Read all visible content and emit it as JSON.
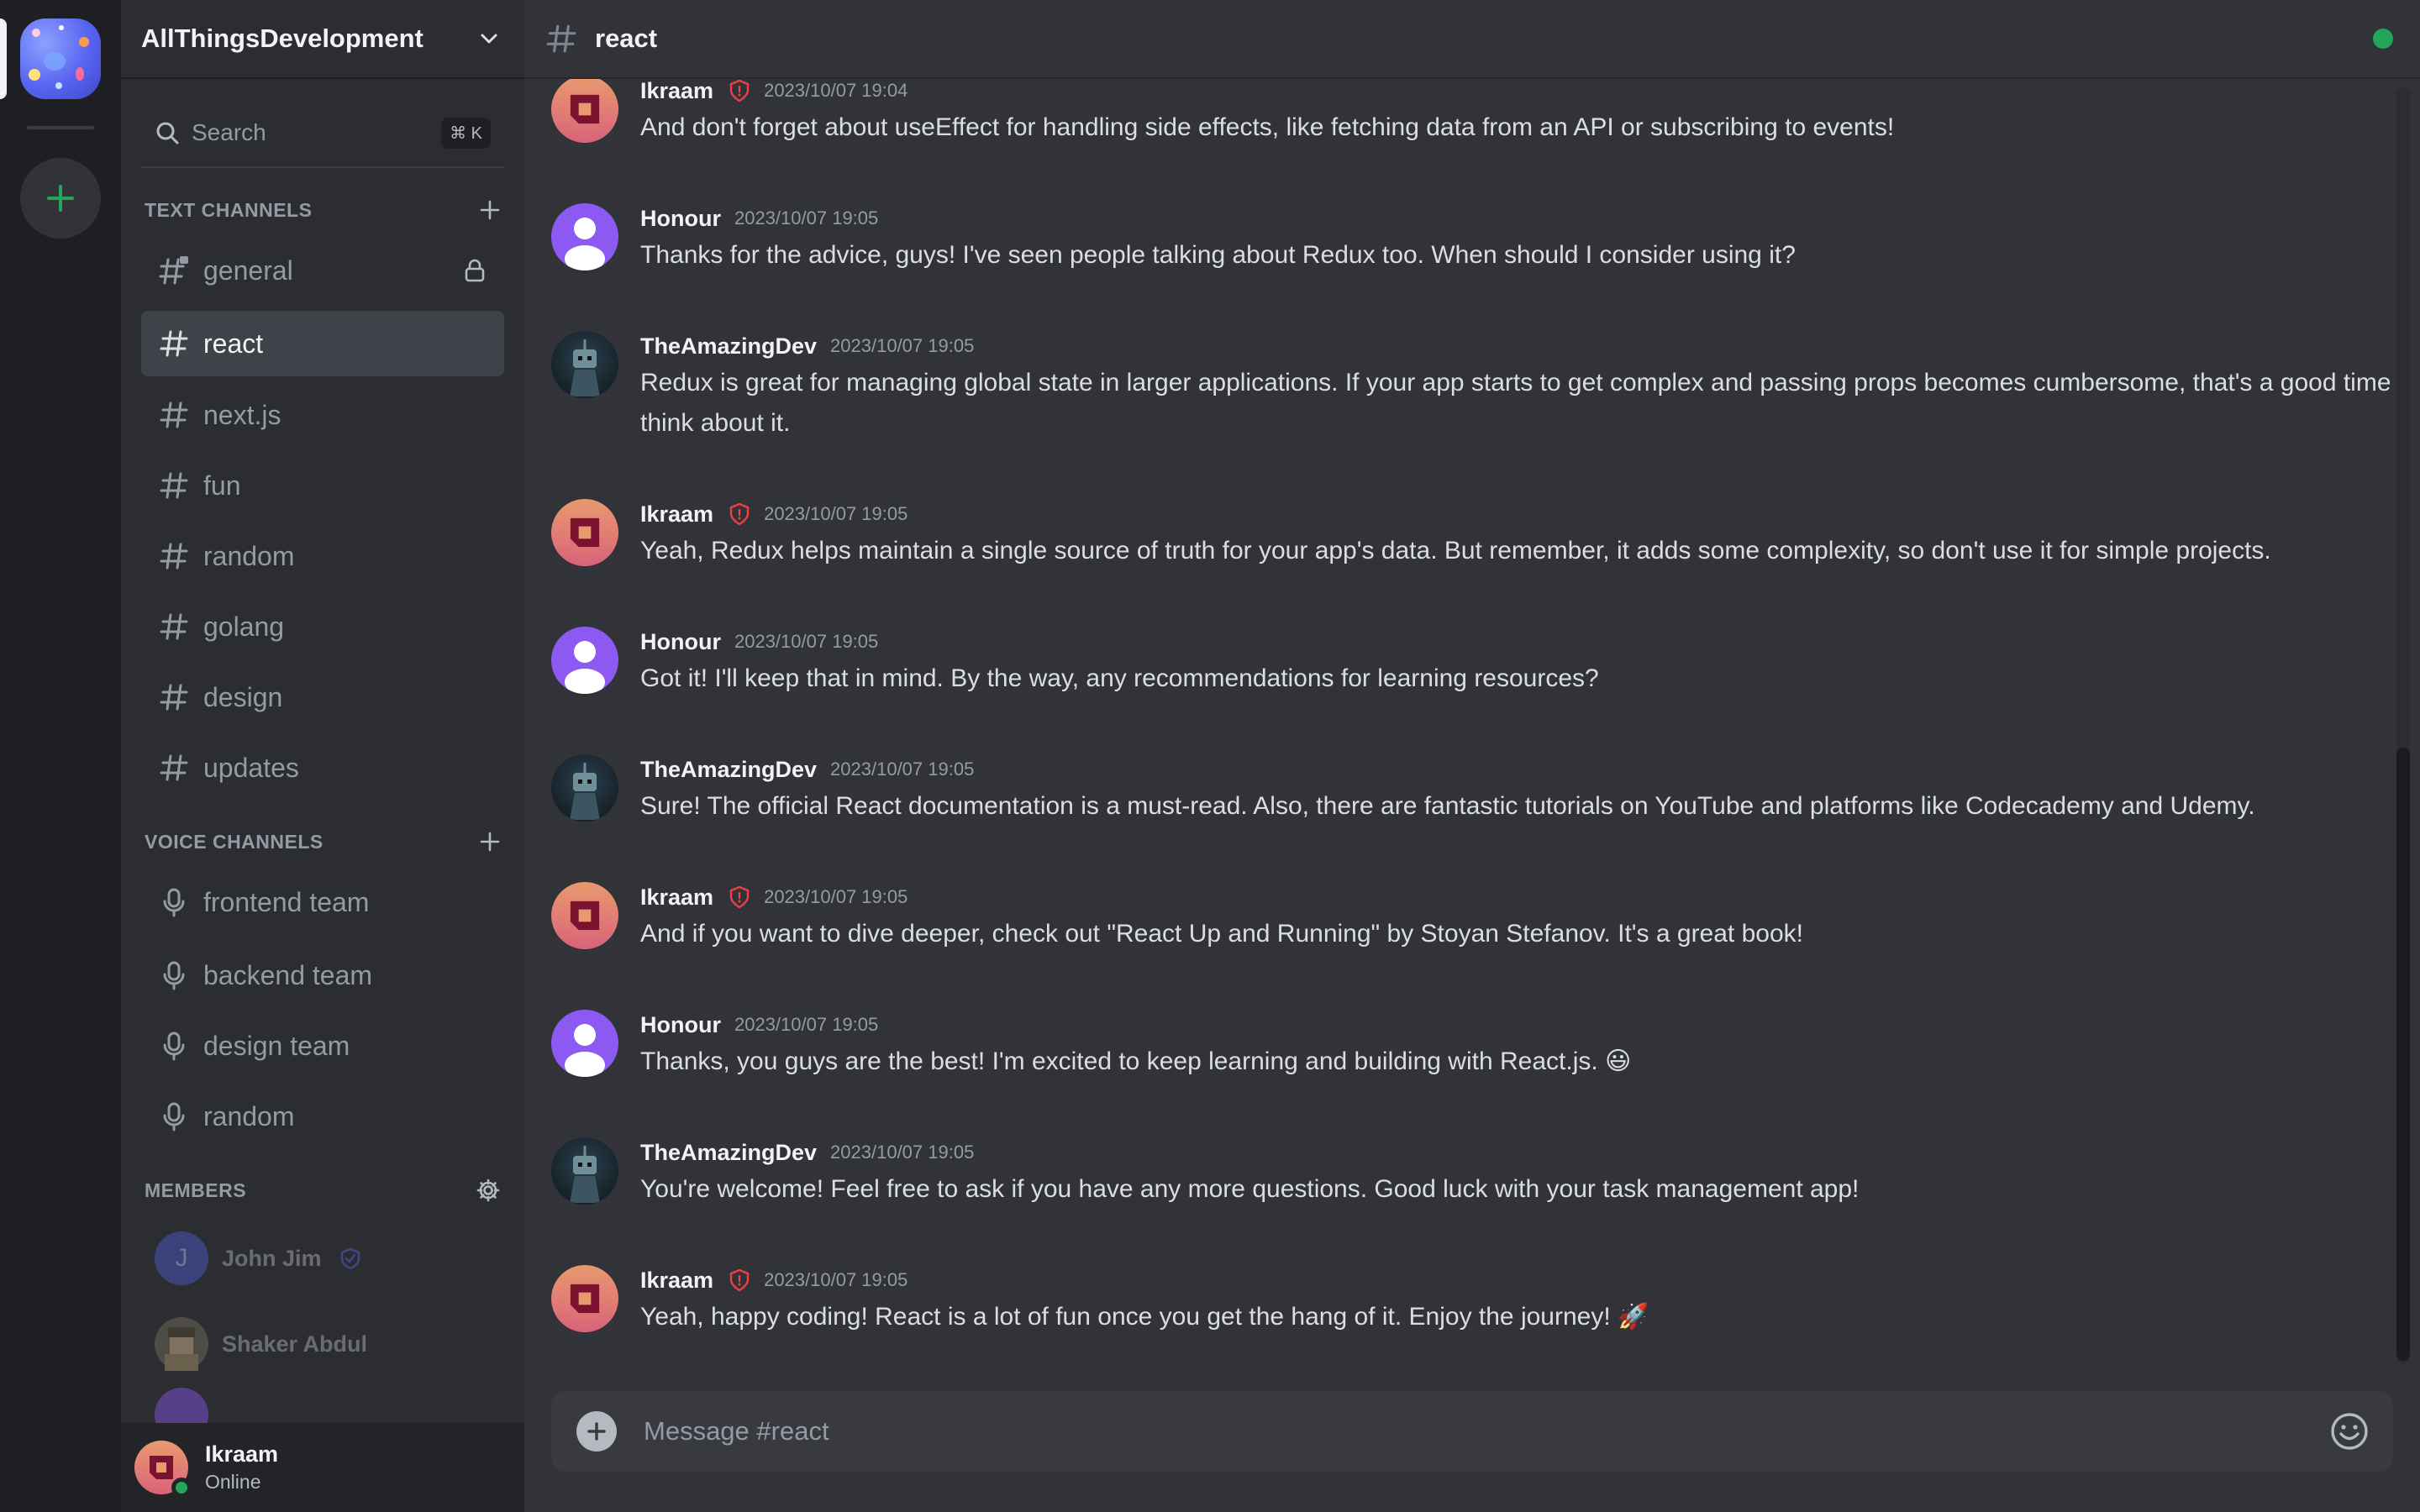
{
  "server": {
    "name": "AllThingsDevelopment"
  },
  "search": {
    "placeholder": "Search",
    "shortcut": "⌘ K"
  },
  "sections": {
    "text": "TEXT CHANNELS",
    "voice": "VOICE CHANNELS",
    "members": "MEMBERS"
  },
  "text_channels": [
    {
      "name": "general"
    },
    {
      "name": "react"
    },
    {
      "name": "next.js"
    },
    {
      "name": "fun"
    },
    {
      "name": "random"
    },
    {
      "name": "golang"
    },
    {
      "name": "design"
    },
    {
      "name": "updates"
    }
  ],
  "voice_channels": [
    {
      "name": "frontend team"
    },
    {
      "name": "backend team"
    },
    {
      "name": "design team"
    },
    {
      "name": "random"
    }
  ],
  "members": [
    {
      "name": "John Jim",
      "initial": "J"
    },
    {
      "name": "Shaker Abdul"
    }
  ],
  "current_user": {
    "name": "Ikraam",
    "status": "Online"
  },
  "chat": {
    "channel": "react",
    "placeholder": "Message #react"
  },
  "messages": [
    {
      "author": "Ikraam",
      "time": "2023/10/07 19:04",
      "text": "And don't forget about useEffect for handling side effects, like fetching data from an API or subscribing to events!"
    },
    {
      "author": "Honour",
      "time": "2023/10/07 19:05",
      "text": "Thanks for the advice, guys! I've seen people talking about Redux too. When should I consider using it?"
    },
    {
      "author": "TheAmazingDev",
      "time": "2023/10/07 19:05",
      "text": "Redux is great for managing global state in larger applications. If your app starts to get complex and passing props becomes cumbersome, that's a good time to think about it."
    },
    {
      "author": "Ikraam",
      "time": "2023/10/07 19:05",
      "text": "Yeah, Redux helps maintain a single source of truth for your app's data. But remember, it adds some complexity, so don't use it for simple projects."
    },
    {
      "author": "Honour",
      "time": "2023/10/07 19:05",
      "text": "Got it! I'll keep that in mind. By the way, any recommendations for learning resources?"
    },
    {
      "author": "TheAmazingDev",
      "time": "2023/10/07 19:05",
      "text": "Sure! The official React documentation is a must-read. Also, there are fantastic tutorials on YouTube and platforms like Codecademy and Udemy."
    },
    {
      "author": "Ikraam",
      "time": "2023/10/07 19:05",
      "text": "And if you want to dive deeper, check out \"React Up and Running\" by Stoyan Stefanov. It's a great book!"
    },
    {
      "author": "Honour",
      "time": "2023/10/07 19:05",
      "text": "Thanks, you guys are the best! I'm excited to keep learning and building with React.js. 😃"
    },
    {
      "author": "TheAmazingDev",
      "time": "2023/10/07 19:05",
      "text": "You're welcome! Feel free to ask if you have any more questions. Good luck with your task management app!"
    },
    {
      "author": "Ikraam",
      "time": "2023/10/07 19:05",
      "text": "Yeah, happy coding! React is a lot of fun once you get the hang of it. Enjoy the journey! 🚀"
    }
  ],
  "colors": {
    "accent_green": "#23a55a",
    "admin_shield": "#f23f43",
    "mod_shield": "#5865f2",
    "active_channel_bg": "#404249"
  },
  "icons": {
    "server_dropdown": "chevron-down-icon",
    "search": "search-icon",
    "text_channel": "hash-icon",
    "voice_channel": "microphone-icon",
    "lock": "lock-icon",
    "add": "plus-icon",
    "settings": "gear-icon",
    "emoji": "emoji-icon"
  }
}
